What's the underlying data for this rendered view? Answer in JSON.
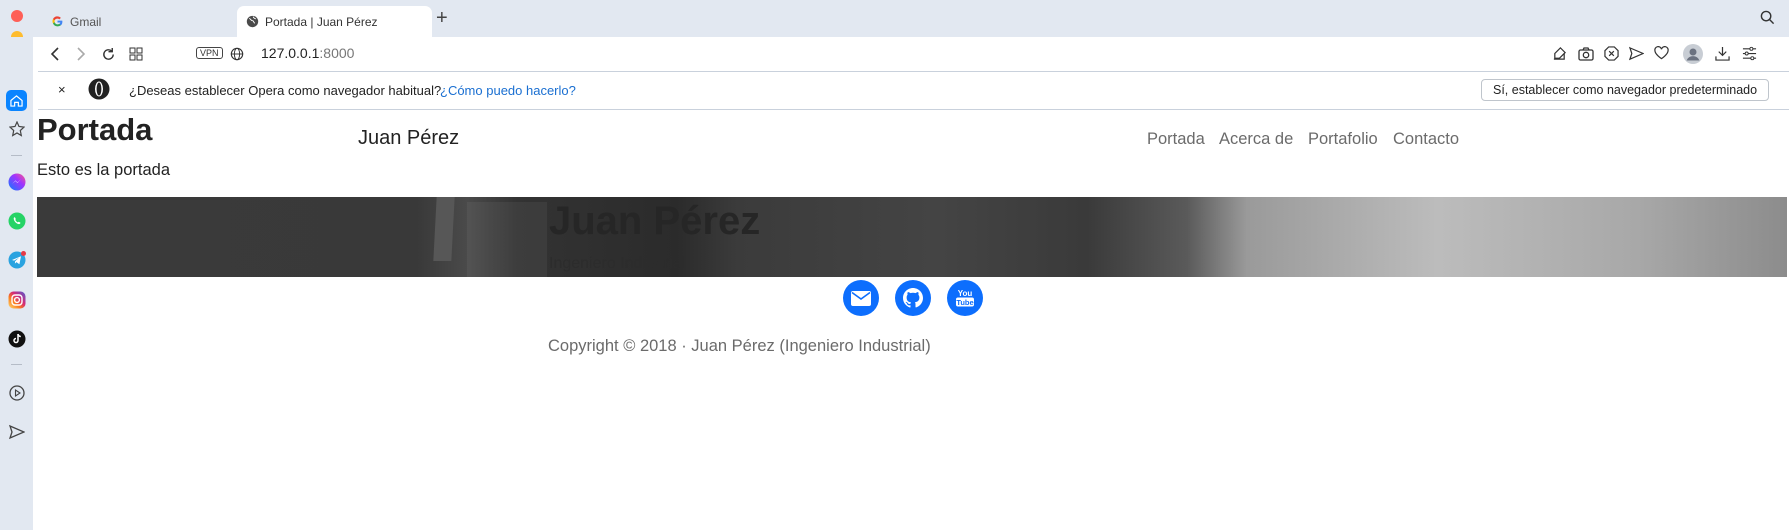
{
  "browser": {
    "tabs": [
      {
        "title": "Gmail",
        "favicon": "google-icon",
        "active": false
      },
      {
        "title": "Portada | Juan Pérez",
        "favicon": "globe-icon",
        "active": true
      }
    ],
    "address": {
      "host": "127.0.0.1",
      "port": ":8000"
    },
    "vpn_label": "VPN"
  },
  "infobar": {
    "close_label": "×",
    "message": "¿Deseas establecer Opera como navegador habitual?",
    "link": "¿Cómo puedo hacerlo?",
    "set_default_button": "Sí, establecer como navegador predeterminado"
  },
  "page": {
    "title": "Portada",
    "subtitle": "Esto es la portada",
    "brand": "Juan Pérez",
    "nav": [
      "Portada",
      "Acerca de",
      "Portafolio",
      "Contacto"
    ],
    "hero": {
      "name": "Juan Pérez",
      "role": "Ingeniero Industrial"
    },
    "social": [
      "email-icon",
      "github-icon",
      "youtube-icon"
    ],
    "youtube_text": [
      "You",
      "Tube"
    ],
    "copyright": "Copyright © 2018 · Juan Pérez (Ingeniero Industrial)"
  },
  "colors": {
    "accent": "#0d6efd",
    "link": "#1a6fd1",
    "chrome": "#e2e8f1"
  }
}
